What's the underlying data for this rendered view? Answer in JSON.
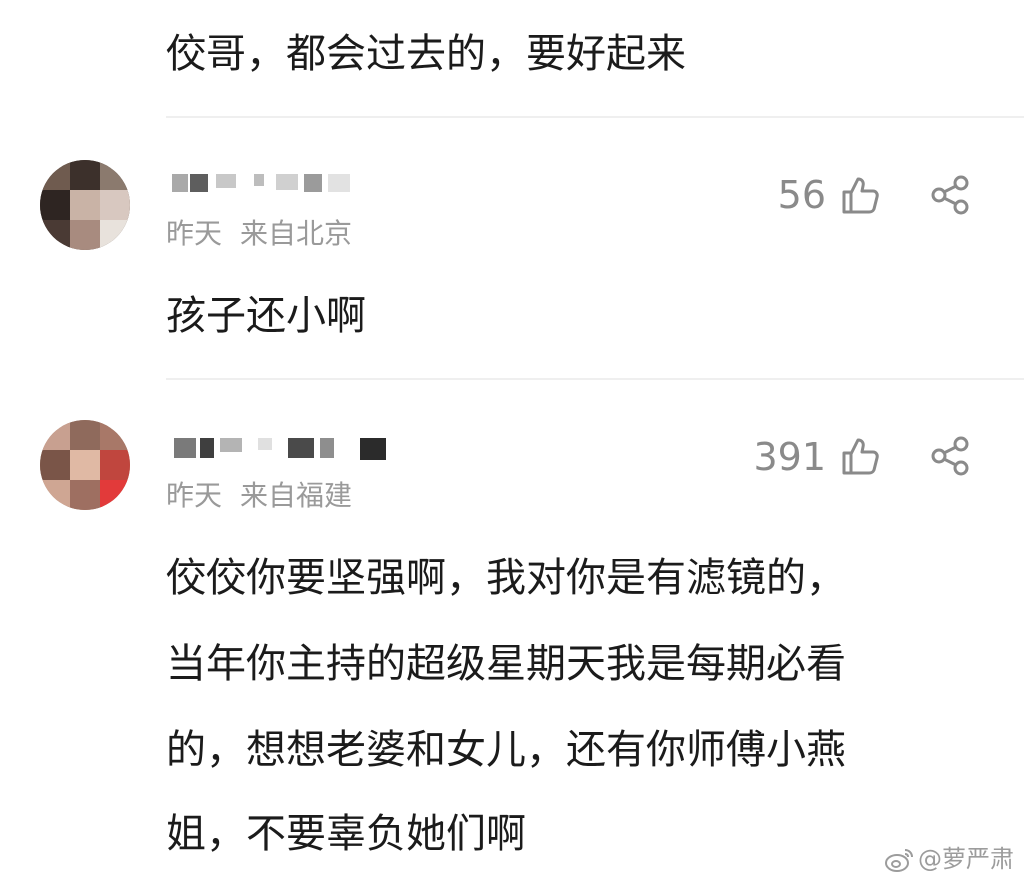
{
  "comments": [
    {
      "id": "c0",
      "text_lines": [
        "佼哥，都会过去的，要好起来"
      ]
    },
    {
      "id": "c1",
      "username": "",
      "date": "昨天",
      "location": "来自北京",
      "likes": "56",
      "text_lines": [
        "孩子还小啊"
      ]
    },
    {
      "id": "c2",
      "username": "",
      "date": "昨天",
      "location": "来自福建",
      "likes": "391",
      "text_lines": [
        "佼佼你要坚强啊，我对你是有滤镜的，",
        "当年你主持的超级星期天我是每期必看",
        "的，想想老婆和女儿，还有你师傅小燕",
        "姐，不要辜负她们啊"
      ]
    }
  ],
  "icons": {
    "like": "thumbs-up-icon",
    "share": "share-icon",
    "weibo": "weibo-logo-icon"
  },
  "watermark": {
    "text": "@萝严肃"
  },
  "colors": {
    "text": "#1b1b1b",
    "meta": "#9a9a9a",
    "icon": "#8a8a8a",
    "divider": "#efefef"
  }
}
